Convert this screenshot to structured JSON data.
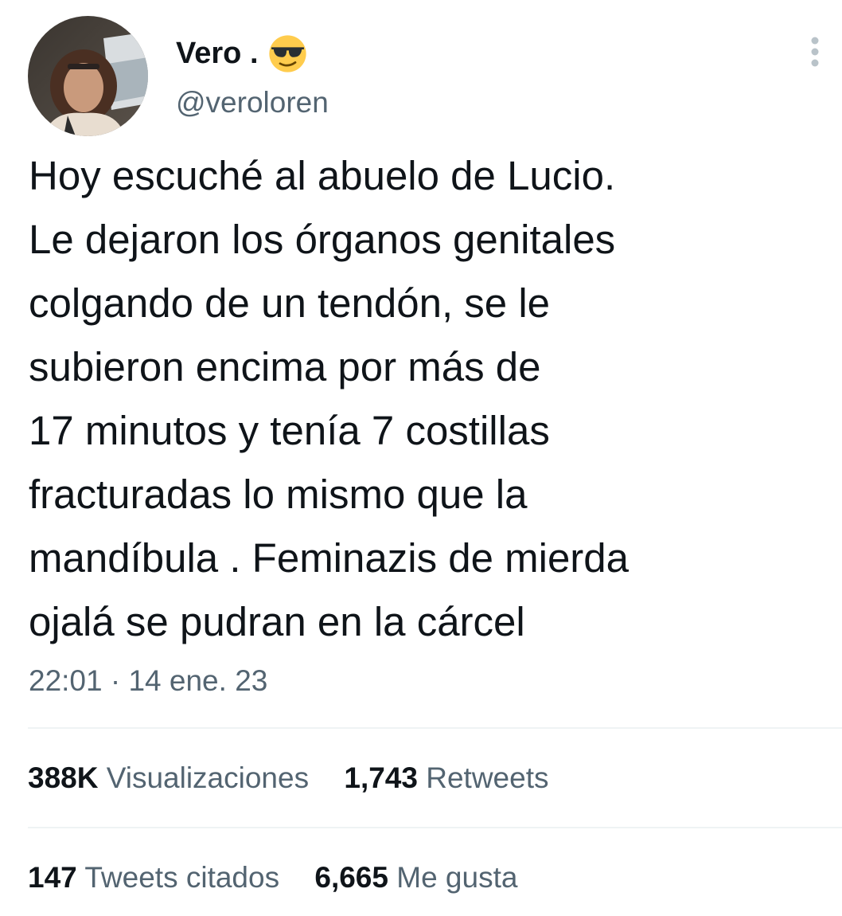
{
  "user": {
    "display_name": "Vero .",
    "name_emoji": "smiling-face-with-sunglasses",
    "handle": "@veroloren",
    "avatar": "profile-photo-woman-in-car"
  },
  "menu_icon": "more-vertical-icon",
  "tweet": {
    "lines": [
      "Hoy escuché al abuelo de Lucio.",
      "Le dejaron los órganos genitales",
      "colgando de un tendón, se le",
      "subieron encima por más de",
      "17 minutos y tenía 7 costillas",
      "fracturadas lo mismo que la",
      "mandíbula . Feminazis de mierda",
      "ojalá se pudran en la cárcel"
    ],
    "timestamp": "22:01 · 14 ene. 23"
  },
  "stats": {
    "views": {
      "value": "388K",
      "label": "Visualizaciones"
    },
    "retweets": {
      "value": "1,743",
      "label": "Retweets"
    },
    "quotes": {
      "value": "147",
      "label": "Tweets citados"
    },
    "likes": {
      "value": "6,665",
      "label": "Me gusta"
    }
  },
  "colors": {
    "text_primary": "#0f1419",
    "text_secondary": "#536471",
    "divider": "#eff3f4",
    "emoji_yellow": "#ffcc4d"
  }
}
